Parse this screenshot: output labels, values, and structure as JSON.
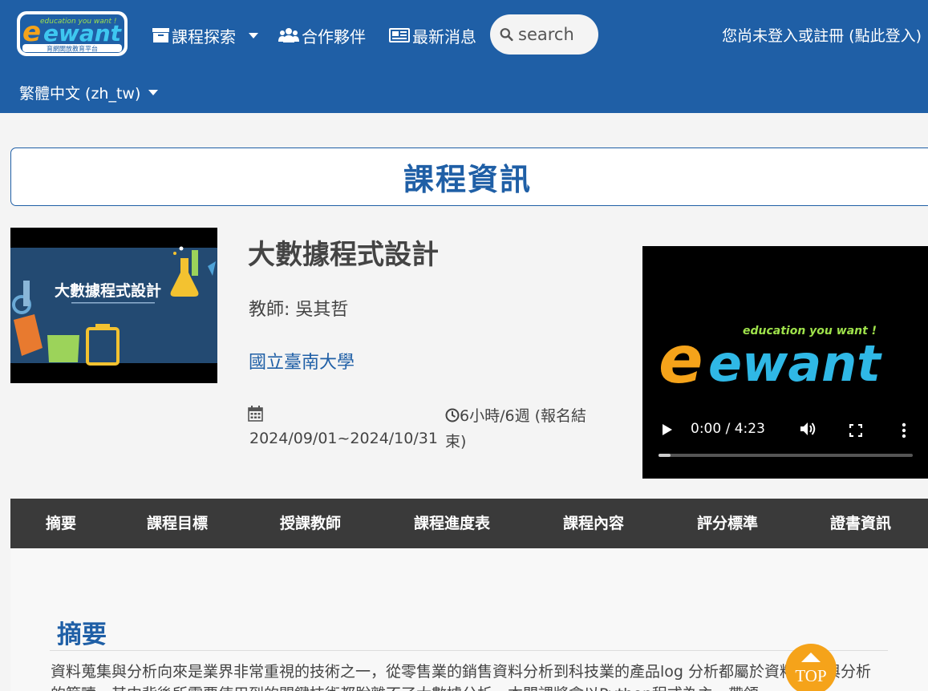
{
  "header": {
    "logo_tagline": "education you want !",
    "logo_sub": "育網開放教育平台",
    "logo_word": "ewant",
    "nav": [
      {
        "label": "課程探索",
        "icon": "archive-box-icon"
      },
      {
        "label": "合作夥伴",
        "icon": "users-icon"
      },
      {
        "label": "最新消息",
        "icon": "newspaper-icon"
      }
    ],
    "search_placeholder": "search",
    "login_text": "您尚未登入或註冊 (點此登入)",
    "language": "繁體中文 (zh_tw)"
  },
  "page_title": "課程資訊",
  "course": {
    "thumb_text": "大數據程式設計",
    "name": "大數據程式設計",
    "teacher": "教師: 吳其哲",
    "school": "國立臺南大學",
    "date_range": "2024/09/01~2024/10/31",
    "duration": "6小時/6週 (報名結束)"
  },
  "video": {
    "logo_tagline": "education you want !",
    "logo_word": "ewant",
    "time": "0:00 / 4:23",
    "progress": 0.0
  },
  "tabs": [
    "摘要",
    "課程目標",
    "授課教師",
    "課程進度表",
    "課程內容",
    "評分標準",
    "證書資訊"
  ],
  "summary": {
    "heading": "摘要",
    "text": "資料蒐集與分析向來是業界非常重視的技術之一，從零售業的銷售資料分析到科技業的產品log 分析都屬於資料蒐集與分析的範疇，其中背後所需要使用到的關鍵技術都脫離不了大數據分析。本門課將會以Python程式為主，帶領"
  },
  "top_button": "TOP",
  "colors": {
    "primary": "#1f5fa6",
    "tab_bg": "#3a3a3a",
    "top_button": "#f5a31a"
  }
}
